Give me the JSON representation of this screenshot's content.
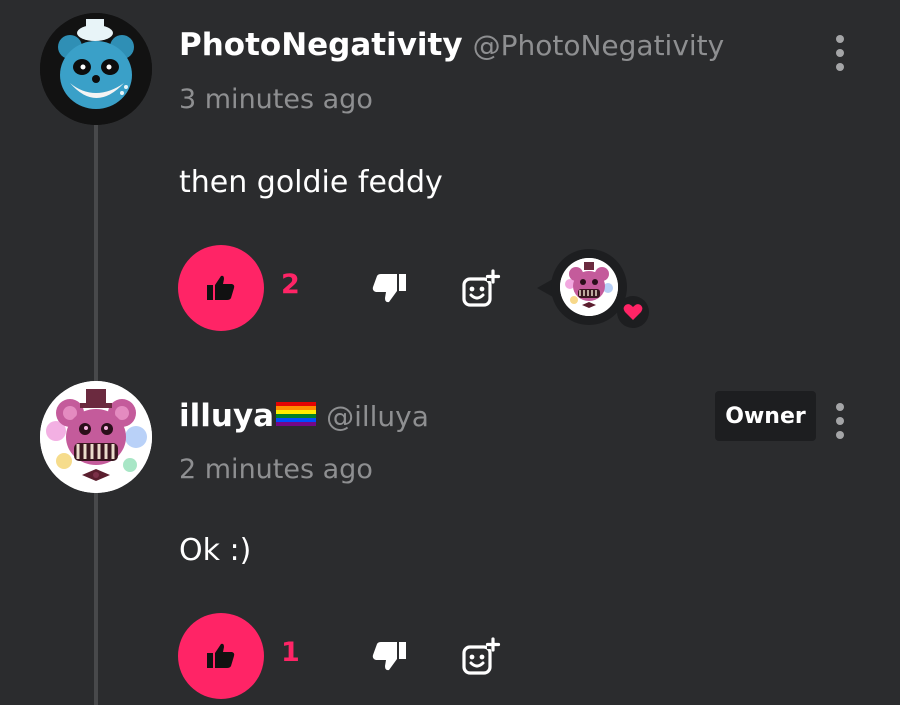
{
  "comments": [
    {
      "display_name": "PhotoNegativity",
      "handle": "@PhotoNegativity",
      "timestamp": "3 minutes ago",
      "text": "then goldie feddy",
      "like_count": "2",
      "avatar_icon": "blue-bear-avatar",
      "reaction": {
        "icon": "heart-icon",
        "color": "#ff2466"
      }
    },
    {
      "display_name": "illuya",
      "flag_icon": "rainbow-flag-icon",
      "handle": "@illuya",
      "badge": "Owner",
      "timestamp": "2 minutes ago",
      "text": "Ok :)",
      "like_count": "1",
      "avatar_icon": "pink-bear-avatar"
    }
  ],
  "colors": {
    "background": "#2b2c2e",
    "accent": "#ff2466",
    "muted_text": "#8e8f91",
    "badge_bg": "#1d1e20"
  }
}
